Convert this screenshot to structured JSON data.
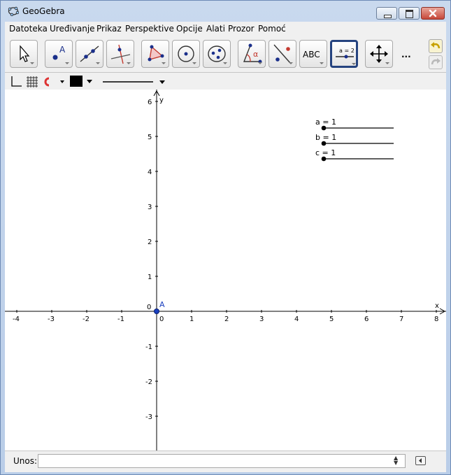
{
  "window": {
    "title": "GeoGebra",
    "app_icon": "geogebra-logo-icon",
    "controls": [
      "minimize-icon",
      "maximize-icon",
      "close-icon"
    ]
  },
  "menu": {
    "items": [
      "Datoteka",
      "Uređivanje",
      "Prikaz",
      "Perspektive",
      "Opcije",
      "Alati",
      "Prozor",
      "Pomoć"
    ]
  },
  "toolbar": {
    "tools": [
      {
        "name": "move",
        "icon": "arrow-pointer-icon"
      },
      {
        "name": "point",
        "icon": "point-icon",
        "label": "A"
      },
      {
        "name": "line",
        "icon": "line-through-two-points-icon"
      },
      {
        "name": "perpendicular",
        "icon": "perpendicular-line-icon"
      },
      {
        "name": "polygon",
        "icon": "polygon-icon"
      },
      {
        "name": "circle",
        "icon": "circle-center-point-icon"
      },
      {
        "name": "conic",
        "icon": "ellipse-icon"
      },
      {
        "name": "angle",
        "icon": "angle-icon",
        "label": "α"
      },
      {
        "name": "reflect",
        "icon": "reflect-about-line-icon"
      },
      {
        "name": "text",
        "icon": "text-icon",
        "label": "ABC"
      },
      {
        "name": "slider",
        "icon": "slider-icon",
        "label": "a = 2",
        "selected": true
      },
      {
        "name": "move-graphics",
        "icon": "move-graphics-view-icon"
      }
    ],
    "more_label": "...",
    "undo_icon": "undo-icon",
    "redo_icon": "redo-icon"
  },
  "stylebar": {
    "axes_icon": "axes-icon",
    "grid_icon": "grid-icon",
    "magnet_icon": "magnet-icon",
    "color": "#000000",
    "line_style_icon": "line-style-icon"
  },
  "graphics": {
    "axis_labels": {
      "x": "x",
      "y": "y"
    },
    "x_ticks": [
      "-4",
      "-3",
      "-2",
      "-1",
      "0",
      "1",
      "2",
      "3",
      "4",
      "5",
      "6",
      "7",
      "8"
    ],
    "y_ticks": [
      "6",
      "5",
      "4",
      "3",
      "2",
      "1",
      "-1",
      "-2",
      "-3"
    ],
    "origin_label": "0",
    "point": {
      "name": "A",
      "x": 0,
      "y": 0,
      "color": "#1a3fbf"
    },
    "sliders": [
      {
        "label": "a = 1",
        "value": 1
      },
      {
        "label": "b = 1",
        "value": 1
      },
      {
        "label": "c = 1",
        "value": 1
      }
    ]
  },
  "input_bar": {
    "label": "Unos:",
    "value": "",
    "spinner_up": "▲",
    "spinner_down": "▼",
    "keyboard_icon": "keyboard-toggle-icon"
  }
}
